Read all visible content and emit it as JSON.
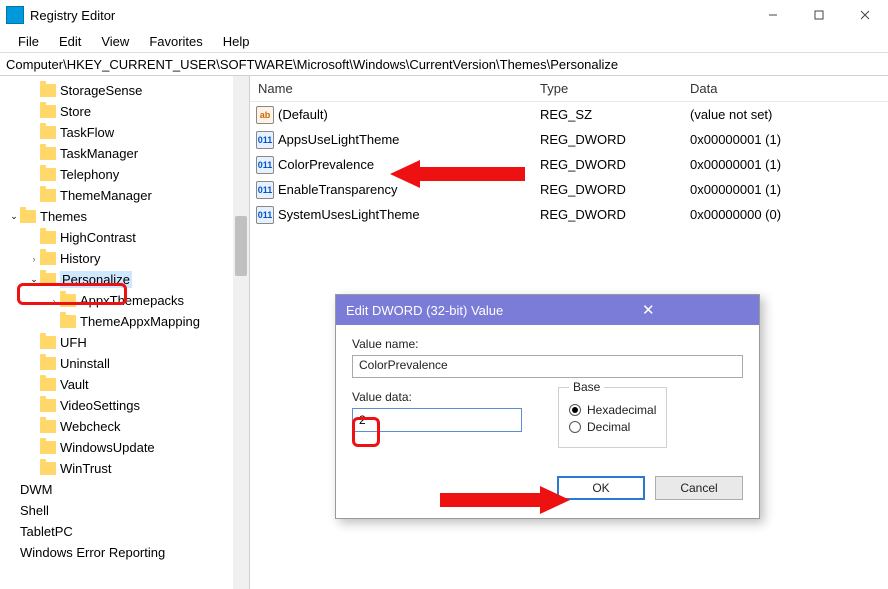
{
  "window": {
    "title": "Registry Editor",
    "menu": [
      "File",
      "Edit",
      "View",
      "Favorites",
      "Help"
    ],
    "address": "Computer\\HKEY_CURRENT_USER\\SOFTWARE\\Microsoft\\Windows\\CurrentVersion\\Themes\\Personalize"
  },
  "tree": [
    {
      "indent": 1,
      "chev": "",
      "label": "StorageSense"
    },
    {
      "indent": 1,
      "chev": "",
      "label": "Store"
    },
    {
      "indent": 1,
      "chev": "",
      "label": "TaskFlow"
    },
    {
      "indent": 1,
      "chev": "",
      "label": "TaskManager"
    },
    {
      "indent": 1,
      "chev": "",
      "label": "Telephony"
    },
    {
      "indent": 1,
      "chev": "",
      "label": "ThemeManager"
    },
    {
      "indent": 0,
      "chev": "open",
      "label": "Themes"
    },
    {
      "indent": 1,
      "chev": "",
      "label": "HighContrast"
    },
    {
      "indent": 1,
      "chev": "closed",
      "label": "History"
    },
    {
      "indent": 1,
      "chev": "open",
      "label": "Personalize",
      "selected": true,
      "highlight": true
    },
    {
      "indent": 2,
      "chev": "closed",
      "label": "AppxThemepacks"
    },
    {
      "indent": 2,
      "chev": "",
      "label": "ThemeAppxMapping"
    },
    {
      "indent": 1,
      "chev": "",
      "label": "UFH"
    },
    {
      "indent": 1,
      "chev": "",
      "label": "Uninstall"
    },
    {
      "indent": 1,
      "chev": "",
      "label": "Vault"
    },
    {
      "indent": 1,
      "chev": "",
      "label": "VideoSettings"
    },
    {
      "indent": 1,
      "chev": "",
      "label": "Webcheck"
    },
    {
      "indent": 1,
      "chev": "",
      "label": "WindowsUpdate"
    },
    {
      "indent": 1,
      "chev": "",
      "label": "WinTrust"
    },
    {
      "indent": 0,
      "chev": "",
      "folder": false,
      "label": "DWM"
    },
    {
      "indent": 0,
      "chev": "",
      "folder": false,
      "label": "Shell"
    },
    {
      "indent": 0,
      "chev": "",
      "folder": false,
      "label": "TabletPC"
    },
    {
      "indent": 0,
      "chev": "",
      "folder": false,
      "label": "Windows Error Reporting"
    }
  ],
  "list": {
    "headers": {
      "name": "Name",
      "type": "Type",
      "data": "Data"
    },
    "rows": [
      {
        "icon": "sz",
        "name": "(Default)",
        "type": "REG_SZ",
        "data": "(value not set)"
      },
      {
        "icon": "dw",
        "name": "AppsUseLightTheme",
        "type": "REG_DWORD",
        "data": "0x00000001 (1)"
      },
      {
        "icon": "dw",
        "name": "ColorPrevalence",
        "type": "REG_DWORD",
        "data": "0x00000001 (1)"
      },
      {
        "icon": "dw",
        "name": "EnableTransparency",
        "type": "REG_DWORD",
        "data": "0x00000001 (1)"
      },
      {
        "icon": "dw",
        "name": "SystemUsesLightTheme",
        "type": "REG_DWORD",
        "data": "0x00000000 (0)"
      }
    ]
  },
  "dialog": {
    "title": "Edit DWORD (32-bit) Value",
    "name_label": "Value name:",
    "name_value": "ColorPrevalence",
    "data_label": "Value data:",
    "data_value": "2",
    "base_label": "Base",
    "hex": "Hexadecimal",
    "dec": "Decimal",
    "ok": "OK",
    "cancel": "Cancel"
  }
}
